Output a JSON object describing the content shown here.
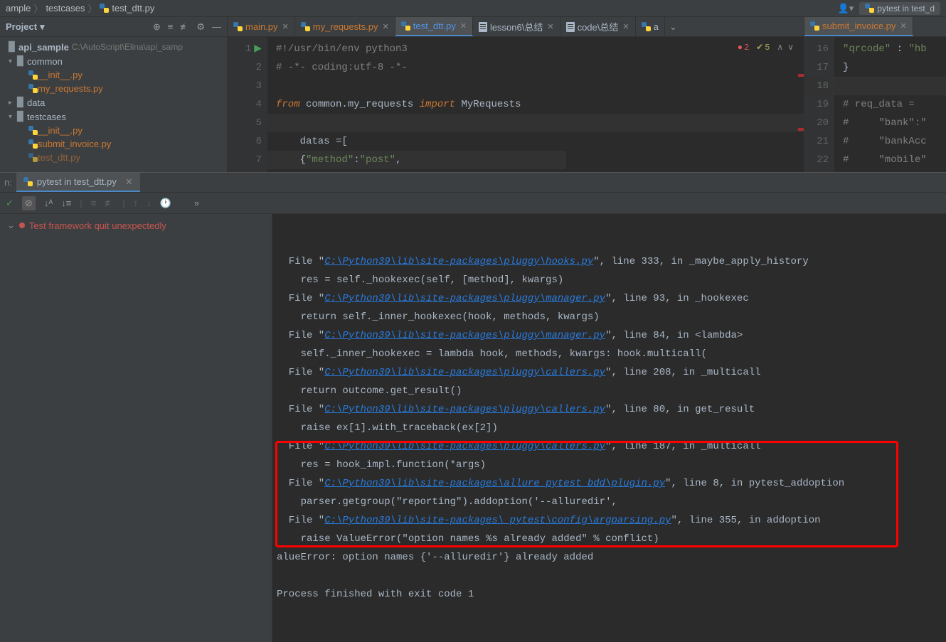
{
  "breadcrumb": {
    "p1": "ample",
    "p2": "testcases",
    "p3": "test_dtt.py"
  },
  "runConfig": "pytest in test_d",
  "projectPanel": {
    "title": "Project",
    "root": {
      "name": "api_sample",
      "path": "C:\\AutoScript\\Elina\\api_samp"
    },
    "tree": {
      "common": "common",
      "init": "__init__.py",
      "myreq": "my_requests.py",
      "data": "data",
      "testcases": "testcases",
      "submit": "submit_invoice.py",
      "testdtt": "test_dtt.py"
    }
  },
  "editorTabs": [
    {
      "label": "main.py",
      "active": false,
      "orange": true
    },
    {
      "label": "my_requests.py",
      "active": false,
      "orange": true
    },
    {
      "label": "test_dtt.py",
      "active": true,
      "blue": true
    },
    {
      "label": "lesson6\\总结",
      "active": false,
      "doc": true
    },
    {
      "label": "code\\总结",
      "active": false,
      "doc": true
    },
    {
      "label": "a",
      "active": false
    }
  ],
  "rightTab": {
    "label": "submit_invoice.py"
  },
  "editorLeft": {
    "lineNumbers": [
      "1",
      "2",
      "3",
      "4",
      "5",
      "6",
      "7"
    ],
    "lines": {
      "l1a": "#!/usr/bin/env python3",
      "l2a": "# -*- coding:utf-8 -*-",
      "l4_from": "from ",
      "l4_mod": "common.my_requests ",
      "l4_import": "import ",
      "l4_cls": "MyRequests",
      "l6": "    datas =[",
      "l7a": "    {",
      "l7b": "\"method\"",
      "l7c": ":",
      "l7d": "\"post\"",
      "l7e": ","
    },
    "errors": "2",
    "warnings": "5"
  },
  "editorRight": {
    "lineNumbers": [
      "16",
      "17",
      "18",
      "19",
      "20",
      "21",
      "22"
    ],
    "lines": {
      "l16a": "\"qrcode\"",
      "l16b": " : ",
      "l16c": "\"hb",
      "l17": "}",
      "l19": "# req_data =",
      "l20": "#     \"bank\":\"",
      "l21": "#     \"bankAcc",
      "l22": "#     \"mobile\""
    }
  },
  "runPanel": {
    "tabLabel": "pytest in test_dtt.py",
    "prefix": "n:",
    "testError": "Test framework quit unexpectedly",
    "finished": "Process finished with exit code 1"
  },
  "traceback": [
    {
      "pre": "  File \"",
      "path": "C:\\Python39\\lib\\site-packages\\pluggy\\hooks.py",
      "post": "\", line 333, in _maybe_apply_history"
    },
    {
      "pre": "    res = self._hookexec(self, [method], kwargs)"
    },
    {
      "pre": "  File \"",
      "path": "C:\\Python39\\lib\\site-packages\\pluggy\\manager.py",
      "post": "\", line 93, in _hookexec"
    },
    {
      "pre": "    return self._inner_hookexec(hook, methods, kwargs)"
    },
    {
      "pre": "  File \"",
      "path": "C:\\Python39\\lib\\site-packages\\pluggy\\manager.py",
      "post": "\", line 84, in <lambda>"
    },
    {
      "pre": "    self._inner_hookexec = lambda hook, methods, kwargs: hook.multicall("
    },
    {
      "pre": "  File \"",
      "path": "C:\\Python39\\lib\\site-packages\\pluggy\\callers.py",
      "post": "\", line 208, in _multicall"
    },
    {
      "pre": "    return outcome.get_result()"
    },
    {
      "pre": "  File \"",
      "path": "C:\\Python39\\lib\\site-packages\\pluggy\\callers.py",
      "post": "\", line 80, in get_result"
    },
    {
      "pre": "    raise ex[1].with_traceback(ex[2])"
    },
    {
      "pre": "  File \"",
      "path": "C:\\Python39\\lib\\site-packages\\pluggy\\callers.py",
      "post": "\", line 187, in _multicall"
    },
    {
      "pre": "    res = hook_impl.function(*args)"
    },
    {
      "pre": "  File \"",
      "path": "C:\\Python39\\lib\\site-packages\\allure_pytest_bdd\\plugin.py",
      "post": "\", line 8, in pytest_addoption"
    },
    {
      "pre": "    parser.getgroup(\"reporting\").addoption('--alluredir',"
    },
    {
      "pre": "  File \"",
      "path": "C:\\Python39\\lib\\site-packages\\_pytest\\config\\argparsing.py",
      "post": "\", line 355, in addoption"
    },
    {
      "pre": "    raise ValueError(\"option names %s already added\" % conflict)"
    },
    {
      "pre": "ValueError: option names {'--alluredir'} already added",
      "trim": true
    }
  ]
}
